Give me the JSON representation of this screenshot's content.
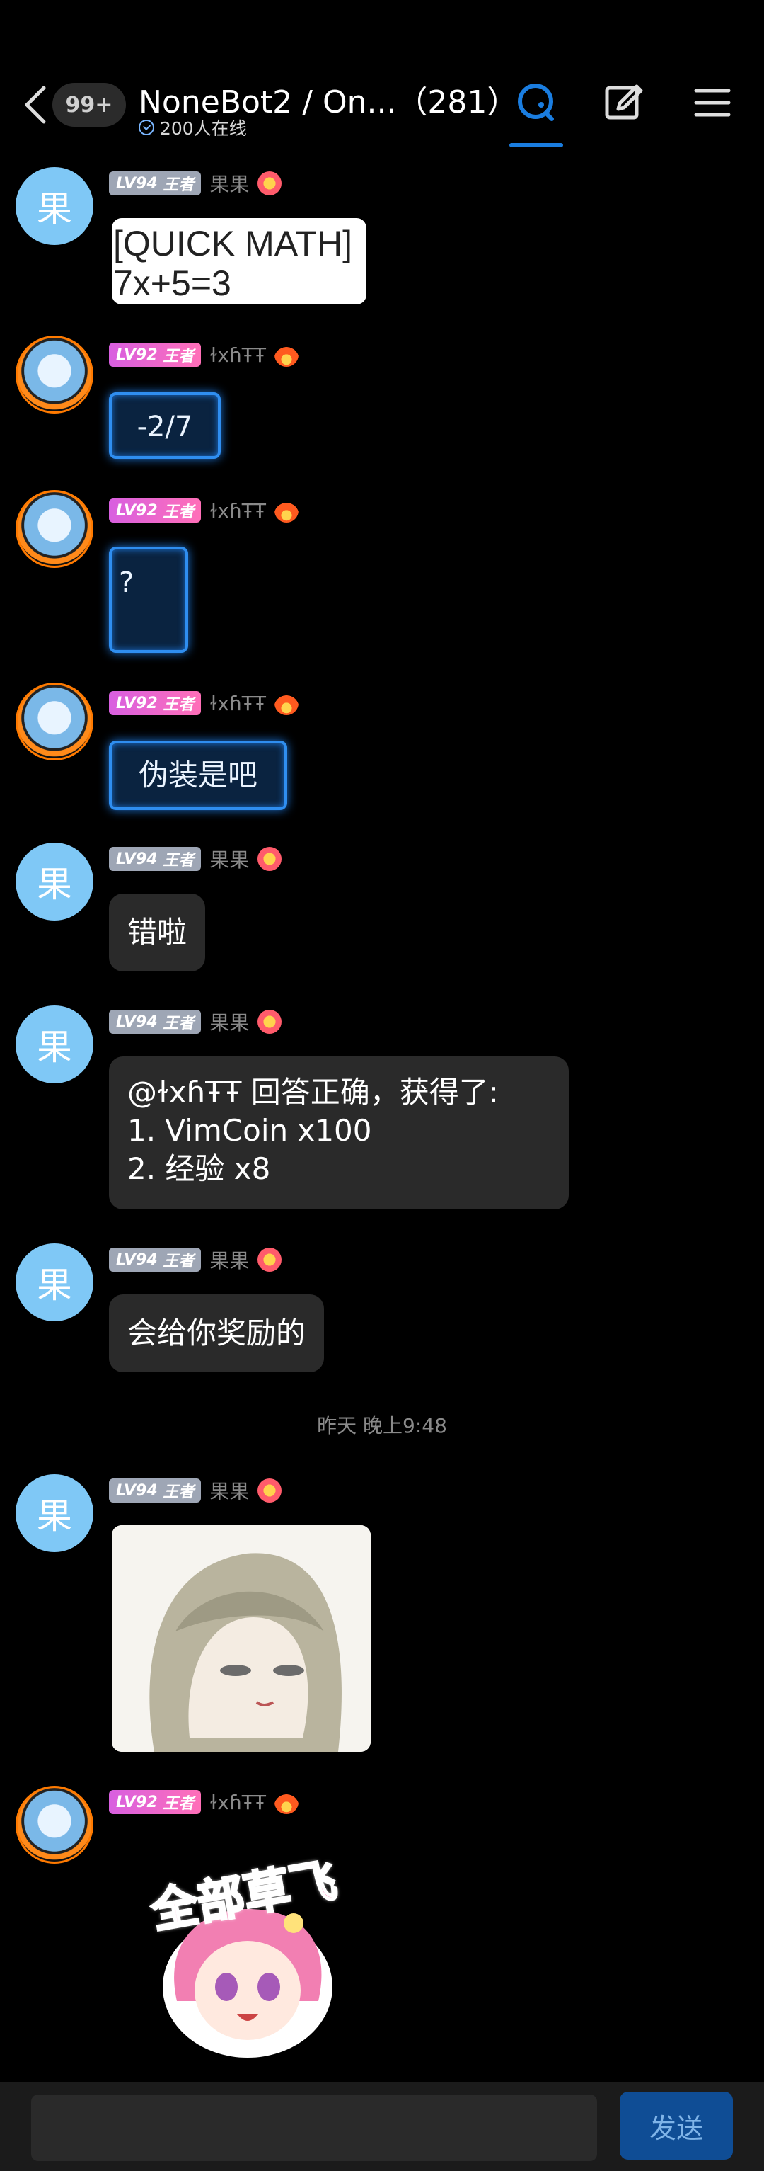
{
  "header": {
    "back_label": "<",
    "unread_badge": "99+",
    "title": "NoneBot2 / On...（281）",
    "online_text": "200人在线",
    "icons": [
      "chat-tab-icon",
      "edit-icon",
      "menu-icon"
    ]
  },
  "messages": [
    {
      "user": "果果",
      "avatar_text": "果",
      "level": "LV94",
      "rank": "王者",
      "type": "image",
      "image_text_line1": "[QUICK MATH]",
      "image_text_line2": "7x+5=3"
    },
    {
      "user": "ɫxɦŦŦ",
      "level": "LV92",
      "rank": "王者",
      "type": "text",
      "text": "-2/7"
    },
    {
      "user": "ɫxɦŦŦ",
      "level": "LV92",
      "rank": "王者",
      "type": "text",
      "text": "?"
    },
    {
      "user": "ɫxɦŦŦ",
      "level": "LV92",
      "rank": "王者",
      "type": "text",
      "text": "伪装是吧"
    },
    {
      "user": "果果",
      "avatar_text": "果",
      "level": "LV94",
      "rank": "王者",
      "type": "text",
      "text": "错啦"
    },
    {
      "user": "果果",
      "avatar_text": "果",
      "level": "LV94",
      "rank": "王者",
      "type": "text",
      "line1": "@ɫxɦŦŦ 回答正确，获得了:",
      "line2": "1. VimCoin x100",
      "line3": "2. 经验 x8"
    },
    {
      "user": "果果",
      "avatar_text": "果",
      "level": "LV94",
      "rank": "王者",
      "type": "text",
      "text": "会给你奖励的"
    },
    {
      "user": "果果",
      "avatar_text": "果",
      "level": "LV94",
      "rank": "王者",
      "type": "image"
    },
    {
      "user": "ɫxɦŦŦ",
      "level": "LV92",
      "rank": "王者",
      "type": "sticker",
      "sticker_text": "全部草飞"
    }
  ],
  "timestamp": "昨天 晚上9:48",
  "input": {
    "placeholder": "",
    "send_label": "发送"
  },
  "colors": {
    "background": "#000000",
    "bubble": "#2a2a2a",
    "accent": "#1a7de0",
    "send_button": "#0f4d95"
  }
}
